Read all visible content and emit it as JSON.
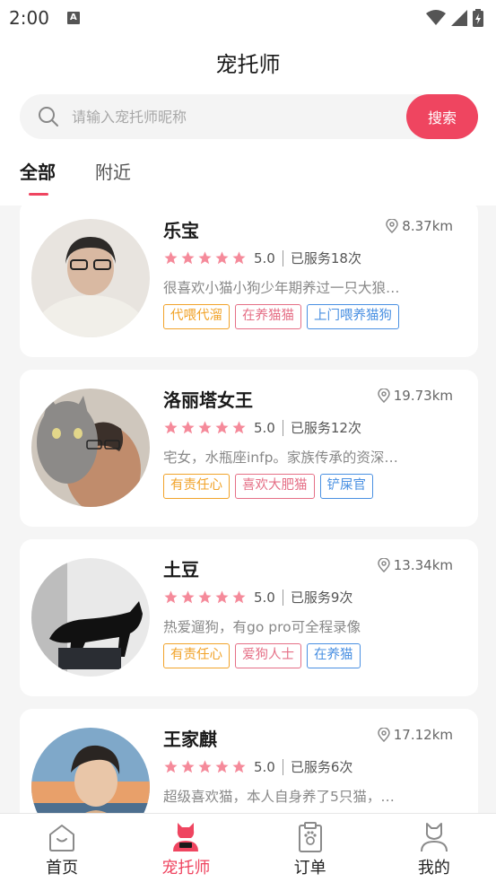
{
  "status_bar": {
    "time": "2:00",
    "notif_letter": "A"
  },
  "header": {
    "title": "宠托师"
  },
  "search": {
    "placeholder": "请输入宠托师昵称",
    "button_label": "搜索"
  },
  "tabs": [
    {
      "label": "全部"
    },
    {
      "label": "附近"
    }
  ],
  "sitters": [
    {
      "name": "乐宝",
      "distance": "8.37km",
      "rating": "5.0",
      "served": "已服务18次",
      "desc": "很喜欢小猫小狗少年期养过一只大狼…",
      "tags": [
        {
          "label": "代喂代溜"
        },
        {
          "label": "在养猫猫"
        },
        {
          "label": "上门喂养猫狗"
        }
      ]
    },
    {
      "name": "洛丽塔女王",
      "distance": "19.73km",
      "rating": "5.0",
      "served": "已服务12次",
      "desc": "宅女，水瓶座infp。家族传承的资深…",
      "tags": [
        {
          "label": "有责任心"
        },
        {
          "label": "喜欢大肥猫"
        },
        {
          "label": "铲屎官"
        }
      ]
    },
    {
      "name": "土豆",
      "distance": "13.34km",
      "rating": "5.0",
      "served": "已服务9次",
      "desc": "热爱遛狗，有go pro可全程录像",
      "tags": [
        {
          "label": "有责任心"
        },
        {
          "label": "爱狗人士"
        },
        {
          "label": "在养猫"
        }
      ]
    },
    {
      "name": "王家麒",
      "distance": "17.12km",
      "rating": "5.0",
      "served": "已服务6次",
      "desc": "超级喜欢猫，本人自身养了5只猫，…",
      "tags": []
    }
  ],
  "bottom_nav": [
    {
      "label": "首页",
      "icon": "home-icon"
    },
    {
      "label": "宠托师",
      "icon": "sitter-icon"
    },
    {
      "label": "订单",
      "icon": "order-icon"
    },
    {
      "label": "我的",
      "icon": "profile-icon"
    }
  ],
  "colors": {
    "accent": "#ef4560",
    "star": "#f58a9a",
    "tag_orange": "#f1a32a",
    "tag_pink": "#e56f86",
    "tag_blue": "#4a90e2"
  }
}
